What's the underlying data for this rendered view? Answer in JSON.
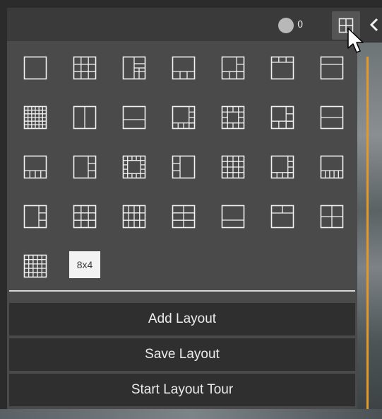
{
  "topbar": {
    "status_count": "0",
    "layout_toggle_icon": "grid-2x2-icon",
    "collapse_icon": "chevron-left-icon"
  },
  "layouts": [
    {
      "name": "1x1"
    },
    {
      "name": "3x3"
    },
    {
      "name": "1+3"
    },
    {
      "name": "1+3-bottom"
    },
    {
      "name": "1+5-bottom-right"
    },
    {
      "name": "3-top+1"
    },
    {
      "name": "2-rows"
    },
    {
      "name": "6x6"
    },
    {
      "name": "2-columns"
    },
    {
      "name": "2-rows-alt"
    },
    {
      "name": "1+7"
    },
    {
      "name": "1+12"
    },
    {
      "name": "1+6"
    },
    {
      "name": "2-rows-thin"
    },
    {
      "name": "1+4-bottom"
    },
    {
      "name": "1+2-right"
    },
    {
      "name": "1+16"
    },
    {
      "name": "1+2-left"
    },
    {
      "name": "4x4"
    },
    {
      "name": "1+9"
    },
    {
      "name": "1+6-bottom-right"
    },
    {
      "name": "1+2-right-alt"
    },
    {
      "name": "3x3-alt"
    },
    {
      "name": "4x3"
    },
    {
      "name": "2x3"
    },
    {
      "name": "1+2-bottom"
    },
    {
      "name": "2-top+1"
    },
    {
      "name": "2x2"
    },
    {
      "name": "5x5"
    }
  ],
  "custom_layout_label": "8x4",
  "menu": {
    "add_layout": "Add Layout",
    "save_layout": "Save Layout",
    "start_tour": "Start Layout Tour"
  },
  "colors": {
    "panel_bg": "#4a4a4a",
    "button_bg": "#2f2f2f",
    "icon_stroke": "#f2f2f2",
    "accent_edge": "#e39a2d"
  }
}
